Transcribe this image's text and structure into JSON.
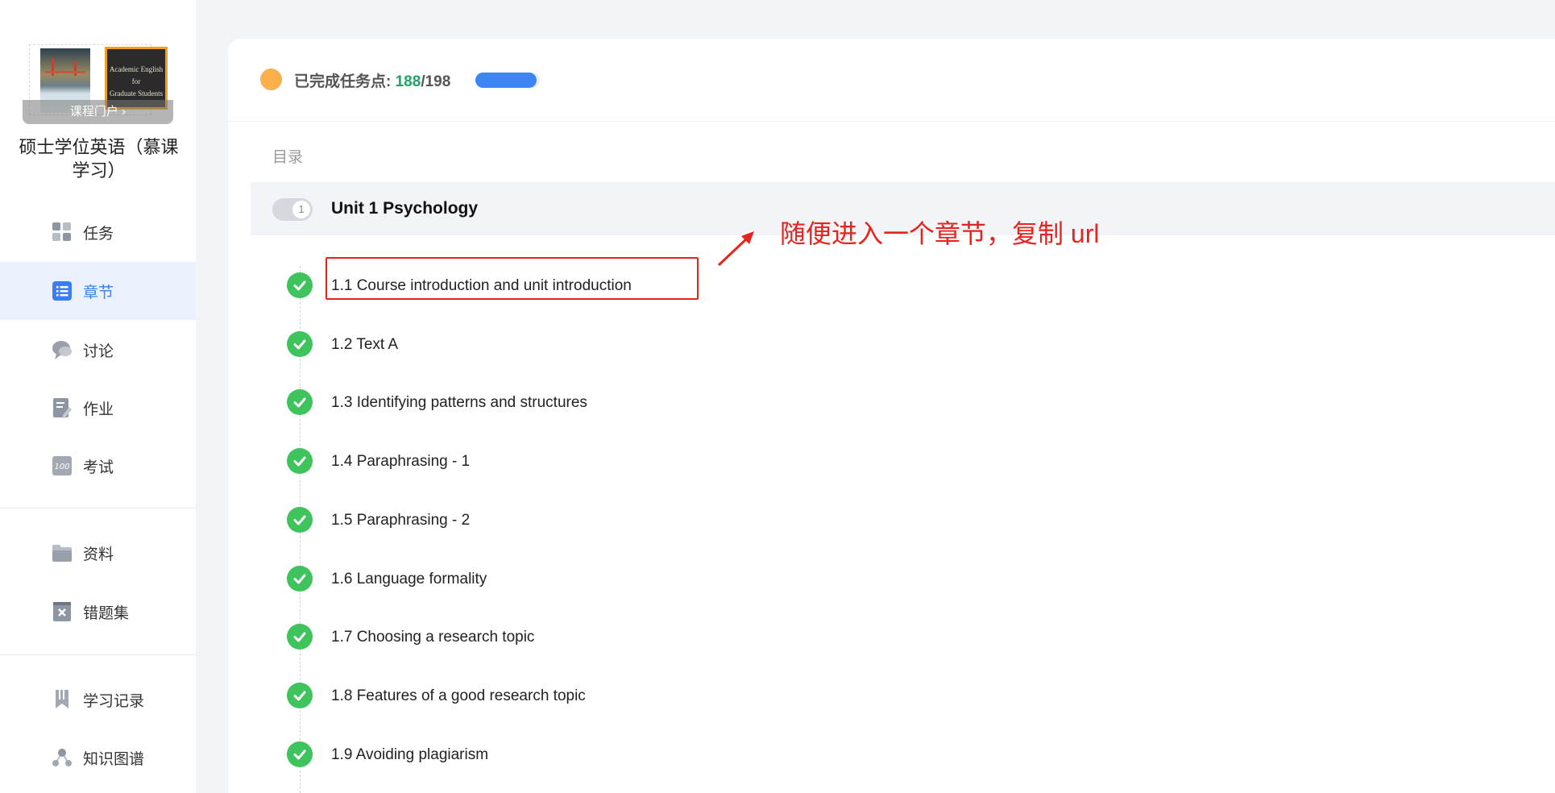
{
  "sidebar": {
    "cover": {
      "book_title_line1": "Academic English for",
      "book_title_line2": "Graduate Students",
      "portal_label": "课程门户 ›"
    },
    "course_title": "硕士学位英语（慕课学习）",
    "nav": [
      {
        "label": "任务",
        "icon": "grid-icon"
      },
      {
        "label": "章节",
        "icon": "list-icon",
        "active": true
      },
      {
        "label": "讨论",
        "icon": "chat-bubble-icon"
      },
      {
        "label": "作业",
        "icon": "edit-document-icon"
      },
      {
        "label": "考试",
        "icon": "score-100-icon"
      },
      {
        "label": "资料",
        "icon": "folder-icon"
      },
      {
        "label": "错题集",
        "icon": "wrong-questions-icon"
      },
      {
        "label": "学习记录",
        "icon": "bookmark-icon"
      },
      {
        "label": "知识图谱",
        "icon": "knowledge-graph-icon"
      }
    ]
  },
  "progress": {
    "label": "已完成任务点:",
    "completed": "188",
    "separator": "/",
    "total": "198",
    "fraction": 0.949
  },
  "toc": {
    "label": "目录",
    "unit": {
      "number": "1",
      "title": "Unit 1 Psychology"
    },
    "lessons": [
      {
        "title": "1.1 Course introduction and unit introduction",
        "status": "completed"
      },
      {
        "title": "1.2 Text A",
        "status": "completed"
      },
      {
        "title": "1.3 Identifying patterns and structures",
        "status": "completed"
      },
      {
        "title": "1.4 Paraphrasing - 1",
        "status": "completed"
      },
      {
        "title": "1.5 Paraphrasing - 2",
        "status": "completed"
      },
      {
        "title": "1.6 Language formality",
        "status": "completed"
      },
      {
        "title": "1.7 Choosing a research topic",
        "status": "completed"
      },
      {
        "title": "1.8 Features of a good research topic",
        "status": "completed"
      },
      {
        "title": "1.9 Avoiding plagiarism",
        "status": "completed"
      }
    ]
  },
  "annotation": {
    "text": "随便进入一个章节，复制 url",
    "color": "#e8231d"
  },
  "colors": {
    "accent": "#3a7ef5",
    "check_green": "#3fc35d",
    "completed_count": "#21a366",
    "progress_dot": "#fbb04c"
  }
}
